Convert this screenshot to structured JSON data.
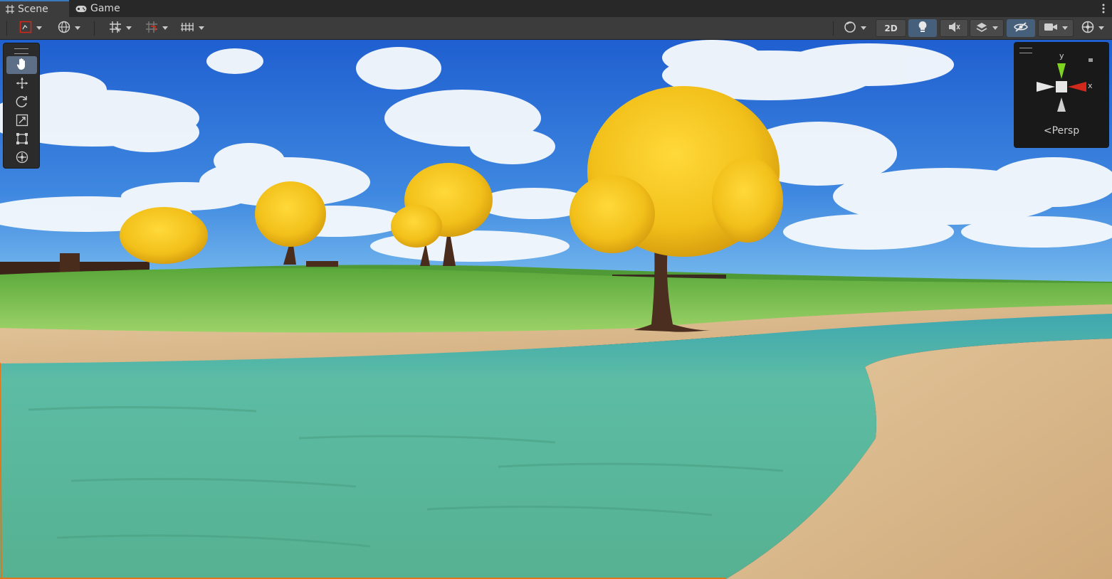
{
  "tabs": [
    {
      "label": "Scene",
      "icon": "grid-icon",
      "active": true
    },
    {
      "label": "Game",
      "icon": "gamepad-icon",
      "active": false
    }
  ],
  "toolbar": {
    "left_tools": [
      "draw-mode",
      "global-local",
      "grid-snap",
      "increment-snap",
      "grid-visibility"
    ],
    "right_tools": [
      "shading-mode",
      "2d-toggle",
      "lighting-toggle",
      "audio-toggle",
      "effects-toggle",
      "scene-visibility",
      "camera-settings",
      "gizmos-toggle"
    ],
    "label_2d": "2D"
  },
  "tools_overlay": {
    "items": [
      "hand-tool",
      "move-tool",
      "rotate-tool",
      "scale-tool",
      "rect-tool",
      "transform-tool"
    ],
    "selected": "hand-tool"
  },
  "orientation_gizmo": {
    "y_label": "y",
    "x_label": "x",
    "projection_label": "Persp",
    "colors": {
      "y_axis": "#7ed321",
      "x_axis": "#d0291b",
      "neutral": "#cfcfcf"
    }
  },
  "scene": {
    "colors": {
      "sky_top": "#1f5fd0",
      "sky_bottom": "#5aa6e8",
      "grass": "#6fb84a",
      "sand": "#d9b98c",
      "water": "#5fb89a",
      "foliage": "#f2c21a"
    }
  }
}
